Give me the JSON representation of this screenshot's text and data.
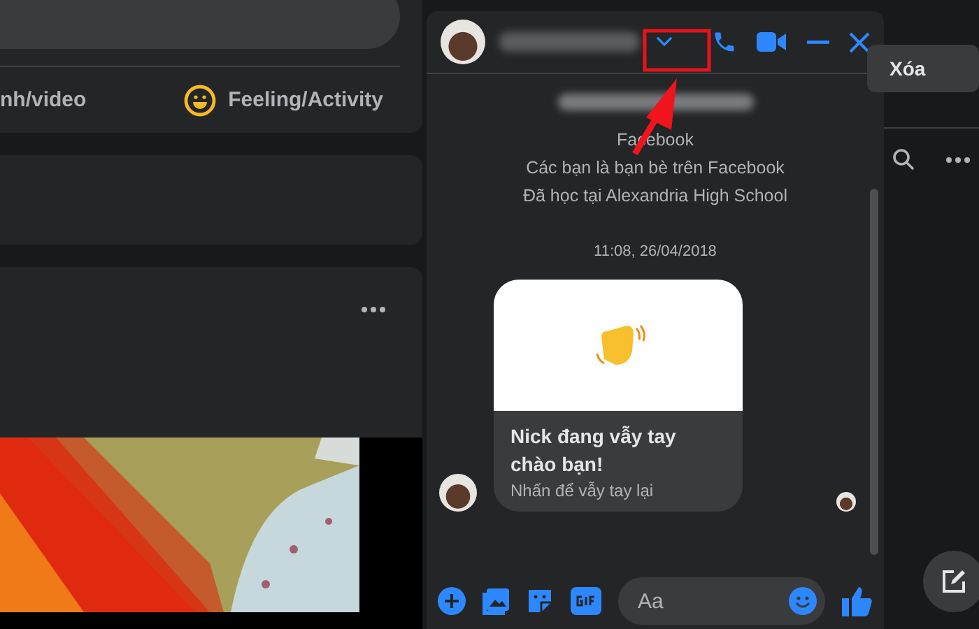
{
  "composer": {
    "photo_video_label": "nh/video",
    "feeling_label": "Feeling/Activity"
  },
  "chat": {
    "intro": [
      "Facebook",
      "Các bạn là bạn bè trên Facebook",
      "Đã học tại Alexandria High School"
    ],
    "timestamp": "11:08, 26/04/2018",
    "wave_card": {
      "title": "Nick đang vẫy tay chào bạn!",
      "subtitle": "Nhấn để vẫy tay lại"
    },
    "message_field": {
      "placeholder": "Aa"
    }
  },
  "right_panel": {
    "button": "Xóa"
  }
}
